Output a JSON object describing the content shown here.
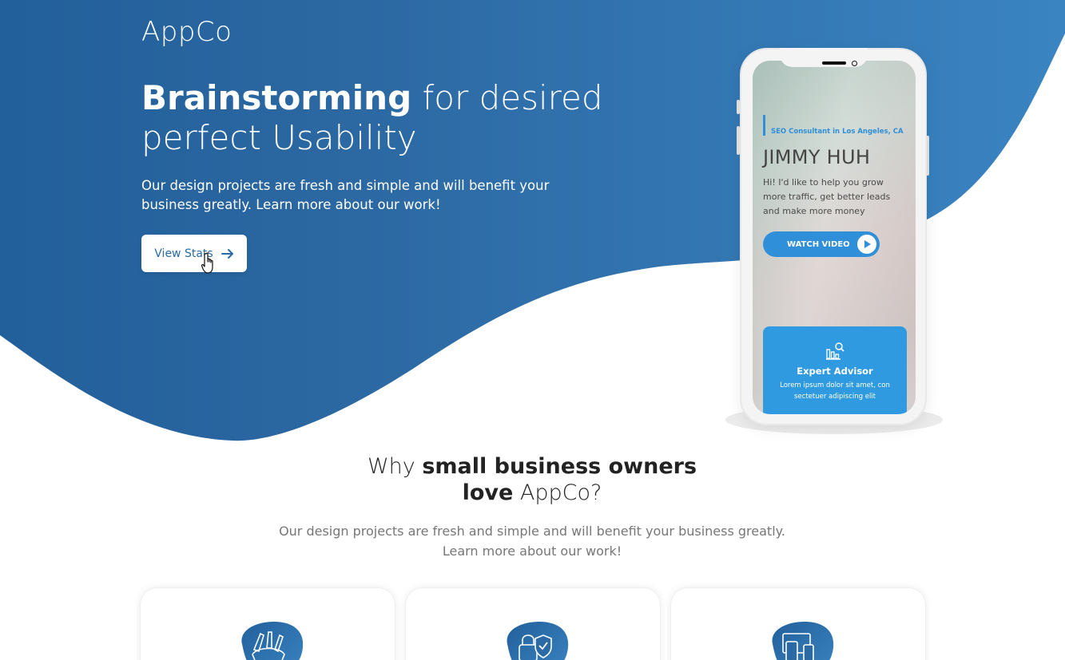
{
  "brand": {
    "logo": "AppCo"
  },
  "hero": {
    "title_bold": "Brainstorming",
    "title_rest_1": " for desired",
    "title_line2": "perfect Usability",
    "subtitle": "Our design projects are fresh and simple and will benefit your business greatly. Learn more about our work!",
    "cta_label": "View Stats"
  },
  "phone": {
    "kicker": "SEO Consultant in Los Angeles, CA",
    "name": "JIMMY HUH",
    "description": "Hi! I'd like to help you grow more traffic, get better leads and make more money",
    "watch_label": "WATCH VIDEO",
    "card_title": "Expert Advisor",
    "card_text": "Lorem ipsum dolor sit amet, con sectetuer adipiscing elit"
  },
  "why": {
    "title_1": "Why ",
    "title_bold_1": "small business owners",
    "title_bold_2": "love",
    "title_2": " AppCo?",
    "subtitle": "Our design projects are fresh and simple and will benefit your business greatly. Learn more about our work!"
  },
  "features": [
    {
      "icon": "design-tools-icon"
    },
    {
      "icon": "security-shield-icon"
    },
    {
      "icon": "responsive-devices-icon"
    }
  ],
  "colors": {
    "hero_dark": "#23609a",
    "hero_light": "#3a83c1",
    "accent": "#2f8fd8",
    "button_text": "#2a6aa6"
  }
}
